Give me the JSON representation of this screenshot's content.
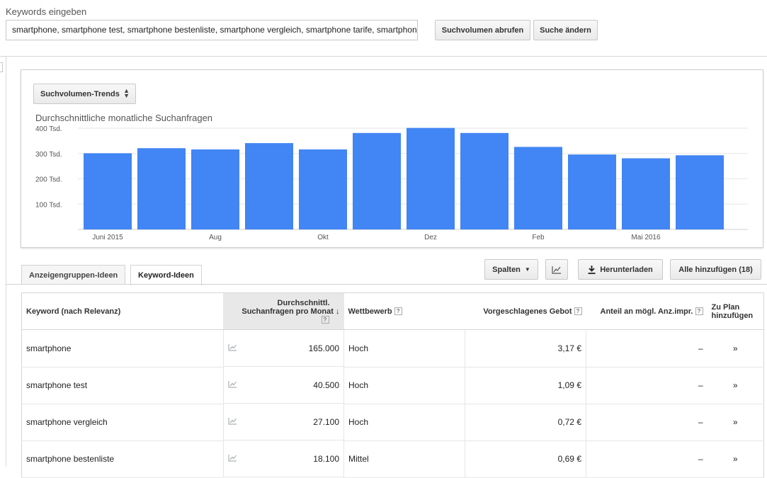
{
  "search": {
    "label": "Keywords eingeben",
    "value": "smartphone, smartphone test, smartphone bestenliste, smartphone vergleich, smartphone tarife, smartphone",
    "button_fetch": "Suchvolumen abrufen",
    "button_edit": "Suche ändern"
  },
  "chart_card": {
    "dropdown_label": "Suchvolumen-Trends",
    "title": "Durchschnittliche monatliche Suchanfragen"
  },
  "chart_data": {
    "type": "bar",
    "title": "Durchschnittliche monatliche Suchanfragen",
    "categories": [
      "Juni 2015",
      "Jul 2015",
      "Aug 2015",
      "Sep 2015",
      "Okt 2015",
      "Nov 2015",
      "Dez 2015",
      "Jan 2016",
      "Feb 2016",
      "Mär 2016",
      "Apr 2016",
      "Mai 2016"
    ],
    "x_tick_labels": [
      "Juni 2015",
      "",
      "Aug",
      "",
      "Okt",
      "",
      "Dez",
      "",
      "Feb",
      "",
      "Mai 2016",
      ""
    ],
    "values": [
      301000,
      321000,
      316000,
      341000,
      316000,
      381000,
      401000,
      381000,
      326000,
      296000,
      281000,
      293000
    ],
    "y_ticks": [
      100000,
      200000,
      300000,
      400000
    ],
    "y_tick_labels": [
      "100 Tsd.",
      "200 Tsd.",
      "300 Tsd.",
      "400 Tsd."
    ],
    "ylim": [
      0,
      400000
    ],
    "grid": true,
    "color": "#4285f4"
  },
  "tabs": {
    "adgroup": "Anzeigengruppen-Ideen",
    "keyword": "Keyword-Ideen"
  },
  "toolbar": {
    "columns": "Spalten",
    "download": "Herunterladen",
    "add_all": "Alle hinzufügen (18)"
  },
  "table": {
    "headers": {
      "keyword": "Keyword (nach Relevanz)",
      "volume_line1": "Durchschnittl.",
      "volume_line2": "Suchanfragen pro Monat",
      "competition": "Wettbewerb",
      "bid": "Vorgeschlagenes Gebot",
      "share": "Anteil an mögl. Anz.impr.",
      "plan_line1": "Zu Plan",
      "plan_line2": "hinzufügen"
    },
    "rows": [
      {
        "keyword": "smartphone",
        "volume": "165.000",
        "competition": "Hoch",
        "bid": "3,17 €",
        "share": "–"
      },
      {
        "keyword": "smartphone test",
        "volume": "40.500",
        "competition": "Hoch",
        "bid": "1,09 €",
        "share": "–"
      },
      {
        "keyword": "smartphone vergleich",
        "volume": "27.100",
        "competition": "Hoch",
        "bid": "0,72 €",
        "share": "–"
      },
      {
        "keyword": "smartphone bestenliste",
        "volume": "18.100",
        "competition": "Mittel",
        "bid": "0,69 €",
        "share": "–"
      }
    ]
  },
  "icons": {
    "trend": "trend-chart-icon",
    "add": "double-chevron-right-icon",
    "download": "download-icon",
    "sort": "arrow-down-icon"
  }
}
